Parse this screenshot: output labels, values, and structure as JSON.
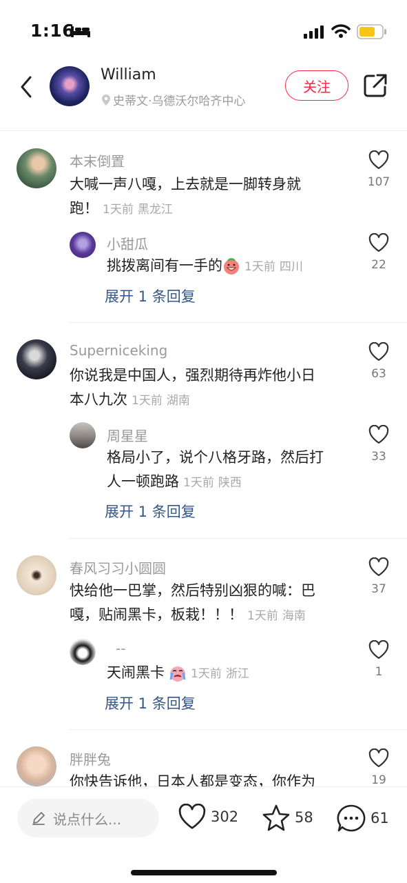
{
  "status_bar": {
    "time": "1:16"
  },
  "header": {
    "author_name": "William",
    "author_location": "史蒂文·乌德沃尔哈齐中心",
    "follow_label": "关注"
  },
  "comments": [
    {
      "name": "本末倒置",
      "text_lines": [
        "大喊一声八嘎，上去就是一脚转身就",
        "跑！"
      ],
      "time": "1天前",
      "location": "黑龙江",
      "likes": "107",
      "reply": {
        "name": "小甜瓜",
        "text_lines": [
          "挑拨离间有一手的"
        ],
        "emoji": "grin-face-emoji",
        "time": "1天前",
        "location": "四川",
        "likes": "22"
      },
      "expand_label": "展开 1 条回复"
    },
    {
      "name": "Superniceking",
      "text_lines": [
        "你说我是中国人，强烈期待再炸他小日",
        "本八九次"
      ],
      "time": "1天前",
      "location": "湖南",
      "likes": "63",
      "reply": {
        "name": "周星星",
        "text_lines": [
          "格局小了，说个八格牙路，然后打",
          "人一顿跑路"
        ],
        "time": "1天前",
        "location": "陕西",
        "likes": "33"
      },
      "expand_label": "展开 1 条回复"
    },
    {
      "name": "春风习习小圆圆",
      "text_lines": [
        "快给他一巴掌，然后特别凶狠的喊：巴",
        "嘎，贴闹黑卡，板栽！！！"
      ],
      "time": "1天前",
      "location": "海南",
      "likes": "37",
      "reply": {
        "name": "--",
        "text_lines": [
          "天闹黑卡"
        ],
        "emoji": "crying-face-emoji",
        "time": "1天前",
        "location": "浙江",
        "likes": "1"
      },
      "expand_label": "展开 1 条回复"
    },
    {
      "name": "胖胖兔",
      "text_lines": [
        "你快告诉他，日本人都是变态，你作为"
      ],
      "likes": "19"
    }
  ],
  "bottom_bar": {
    "input_placeholder": "说点什么...",
    "likes": "302",
    "stars": "58",
    "comments": "61"
  },
  "colors": {
    "accent": "#ff2442",
    "link": "#34568b"
  }
}
